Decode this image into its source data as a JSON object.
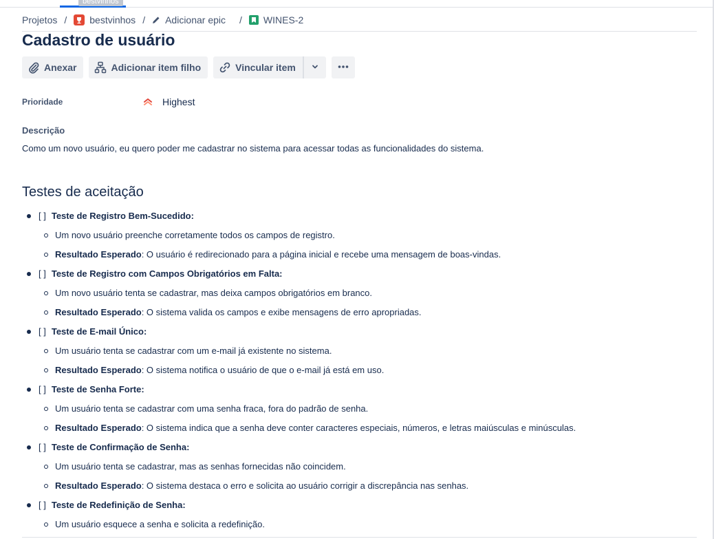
{
  "top": {
    "tooltip": "bestvinhos"
  },
  "breadcrumb": {
    "items": [
      {
        "label": "Projetos",
        "icon": ""
      },
      {
        "label": "bestvinhos",
        "icon": "project-avatar-icon"
      },
      {
        "label": "Adicionar epic",
        "icon": "pencil-icon"
      },
      {
        "label": "WINES-2",
        "icon": "story-icon"
      }
    ],
    "separator": "/"
  },
  "issue": {
    "title": "Cadastro de usuário"
  },
  "toolbar": {
    "attach_label": "Anexar",
    "add_child_label": "Adicionar item filho",
    "link_label": "Vincular item"
  },
  "fields": {
    "priority_label": "Prioridade",
    "priority_value": "Highest"
  },
  "description": {
    "label": "Descrição",
    "text": "Como um novo usuário, eu quero poder me cadastrar no sistema para acessar todas as funcionalidades do sistema."
  },
  "acceptance": {
    "heading": "Testes de aceitação",
    "checkbox": "[ ]",
    "expected_label": "Resultado Esperado",
    "tests": [
      {
        "title": "Teste de Registro Bem-Sucedido:",
        "scenario": "Um novo usuário preenche corretamente todos os campos de registro.",
        "expected": ": O usuário é redirecionado para a página inicial e recebe uma mensagem de boas-vindas."
      },
      {
        "title": "Teste de Registro com Campos Obrigatórios em Falta:",
        "scenario": "Um novo usuário tenta se cadastrar, mas deixa campos obrigatórios em branco.",
        "expected": ": O sistema valida os campos e exibe mensagens de erro apropriadas."
      },
      {
        "title": "Teste de E-mail Único:",
        "scenario": "Um usuário tenta se cadastrar com um e-mail já existente no sistema.",
        "expected": ": O sistema notifica o usuário de que o e-mail já está em uso."
      },
      {
        "title": "Teste de Senha Forte:",
        "scenario": "Um usuário tenta se cadastrar com uma senha fraca, fora do padrão de senha.",
        "expected": ": O sistema indica que a senha deve conter caracteres especiais, números, e letras maiúsculas e minúsculas."
      },
      {
        "title": "Teste de Confirmação de Senha:",
        "scenario": "Um usuário tenta se cadastrar, mas as senhas fornecidas não coincidem.",
        "expected": ": O sistema destaca o erro e solicita ao usuário corrigir a discrepância nas senhas."
      },
      {
        "title": "Teste de Redefinição de Senha:",
        "scenario": "Um usuário esquece a senha e solicita a redefinição."
      }
    ]
  },
  "colors": {
    "text": "#172b4d",
    "subtle": "#44546f",
    "priority": "#e2483d",
    "story": "#22a06b",
    "project_avatar": "#e34935",
    "accent": "#0c66e4"
  }
}
